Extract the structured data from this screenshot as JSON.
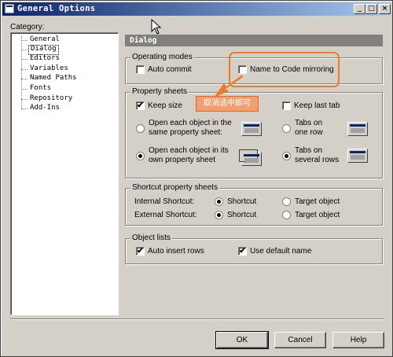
{
  "window": {
    "title": "General Options",
    "controls": {
      "minimize": "_",
      "maximize": "□",
      "close": "×"
    }
  },
  "category": {
    "label": "Category:",
    "items": [
      {
        "label": "General",
        "selected": false
      },
      {
        "label": "Dialog",
        "selected": true
      },
      {
        "label": "Editors",
        "selected": false
      },
      {
        "label": "Variables",
        "selected": false
      },
      {
        "label": "Named Paths",
        "selected": false
      },
      {
        "label": "Fonts",
        "selected": false
      },
      {
        "label": "Repository",
        "selected": false
      },
      {
        "label": "Add-Ins",
        "selected": false
      }
    ]
  },
  "panel": {
    "header": "Dialog",
    "operating_modes": {
      "title": "Operating modes",
      "auto_commit": {
        "label": "Auto commit",
        "checked": false
      },
      "name_to_code": {
        "label": "Name to Code mirroring",
        "checked": false
      }
    },
    "property_sheets": {
      "title": "Property sheets",
      "keep_size": {
        "label": "Keep size",
        "checked": true
      },
      "keep_last_tab": {
        "label": "Keep last tab",
        "checked": false
      },
      "open_same_line1": "Open each object in the",
      "open_same_line2": "same property sheet:",
      "open_same_checked": false,
      "open_own_line1": "Open each object in its",
      "open_own_line2": "own property sheet",
      "open_own_checked": true,
      "tabs_one_line1": "Tabs on",
      "tabs_one_line2": "one row",
      "tabs_one_checked": false,
      "tabs_several_line1": "Tabs on",
      "tabs_several_line2": "several rows",
      "tabs_several_checked": true
    },
    "shortcut": {
      "title": "Shortcut property sheets",
      "internal_label": "Internal Shortcut:",
      "external_label": "External Shortcut:",
      "option_shortcut": "Shortcut",
      "option_target": "Target object",
      "internal_value": "Shortcut",
      "external_value": "Shortcut"
    },
    "object_lists": {
      "title": "Object lists",
      "auto_insert": {
        "label": "Auto insert rows",
        "checked": true
      },
      "use_default": {
        "label": "Use default name",
        "checked": true
      }
    }
  },
  "annotation": {
    "note": "取消选中即可",
    "color": "#f07a2a"
  },
  "buttons": {
    "ok": "OK",
    "cancel": "Cancel",
    "help": "Help"
  },
  "colors": {
    "face": "#d4d0c8",
    "title_start": "#0a246a",
    "title_end": "#a6caf0",
    "header": "#808080"
  }
}
